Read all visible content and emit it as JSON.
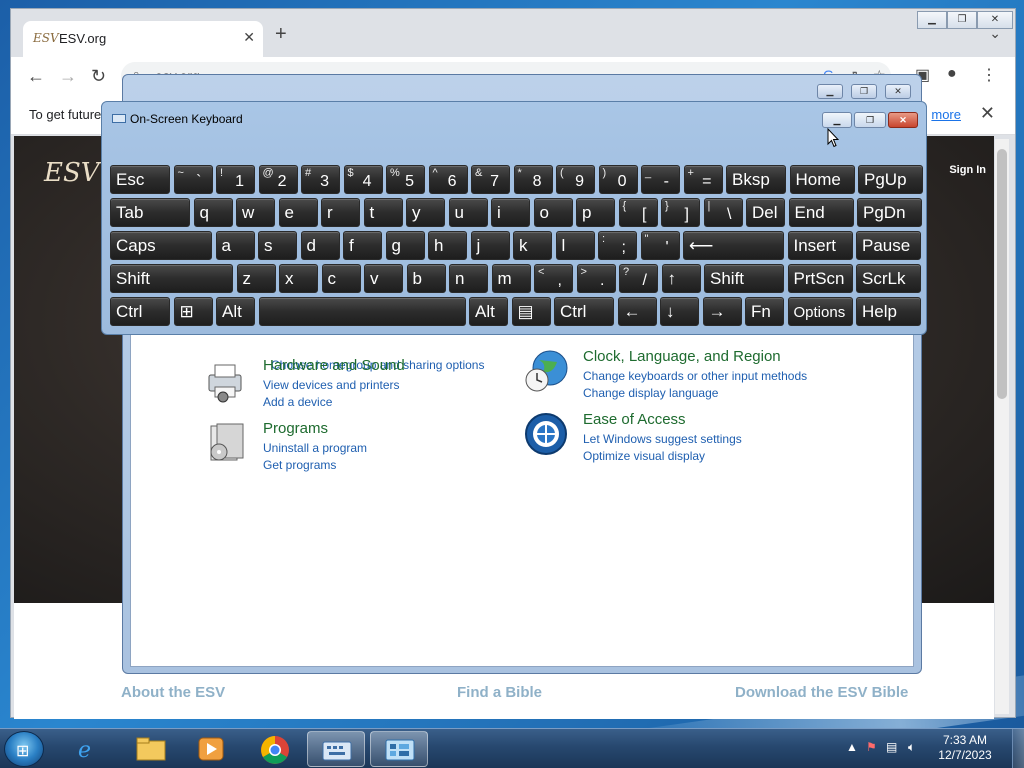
{
  "browser": {
    "tab_title": "ESV.org",
    "tab_favicon": "ESV",
    "url": "esv.org",
    "infobar_text": "To get future",
    "infobar_link": "more"
  },
  "esv_page": {
    "logo": "ESV",
    "sign_in": "Sign In",
    "footer_links": [
      "About the ESV",
      "Find a Bible",
      "Download the ESV Bible"
    ]
  },
  "control_panel": {
    "partial_link": "Choose homegroup and sharing options",
    "items": [
      {
        "title": "Hardware and Sound",
        "links": [
          "View devices and printers",
          "Add a device"
        ],
        "icon": "printer-icon"
      },
      {
        "title": "Programs",
        "links": [
          "Uninstall a program",
          "Get programs"
        ],
        "icon": "programs-icon"
      },
      {
        "title": "Clock, Language, and Region",
        "links": [
          "Change keyboards or other input methods",
          "Change display language"
        ],
        "icon": "globe-clock-icon"
      },
      {
        "title": "Ease of Access",
        "links": [
          "Let Windows suggest settings",
          "Optimize visual display"
        ],
        "icon": "ease-of-access-icon"
      }
    ]
  },
  "osk": {
    "title": "On-Screen Keyboard",
    "rows": [
      [
        [
          "Esc",
          ""
        ],
        [
          "~",
          "`"
        ],
        [
          "!",
          "1"
        ],
        [
          "@",
          "2"
        ],
        [
          "#",
          "3"
        ],
        [
          "$",
          "4"
        ],
        [
          "%",
          "5"
        ],
        [
          "^",
          "6"
        ],
        [
          "&",
          "7"
        ],
        [
          "*",
          "8"
        ],
        [
          "(",
          "9"
        ],
        [
          ")",
          "0"
        ],
        [
          "_",
          "-"
        ],
        [
          "+",
          "="
        ],
        [
          "Bksp",
          ""
        ],
        [
          "Home",
          ""
        ],
        [
          "PgUp",
          ""
        ]
      ],
      [
        [
          "Tab",
          ""
        ],
        [
          "q",
          ""
        ],
        [
          "w",
          ""
        ],
        [
          "e",
          ""
        ],
        [
          "r",
          ""
        ],
        [
          "t",
          ""
        ],
        [
          "y",
          ""
        ],
        [
          "u",
          ""
        ],
        [
          "i",
          ""
        ],
        [
          "o",
          ""
        ],
        [
          "p",
          ""
        ],
        [
          "{",
          "["
        ],
        [
          "}",
          "]"
        ],
        [
          "|",
          "\\"
        ],
        [
          "Del",
          ""
        ],
        [
          "End",
          ""
        ],
        [
          "PgDn",
          ""
        ]
      ],
      [
        [
          "Caps",
          ""
        ],
        [
          "a",
          ""
        ],
        [
          "s",
          ""
        ],
        [
          "d",
          ""
        ],
        [
          "f",
          ""
        ],
        [
          "g",
          ""
        ],
        [
          "h",
          ""
        ],
        [
          "j",
          ""
        ],
        [
          "k",
          ""
        ],
        [
          "l",
          ""
        ],
        [
          ":",
          ";"
        ],
        [
          "\"",
          "'"
        ],
        [
          "⟵",
          ""
        ],
        [
          "Insert",
          ""
        ],
        [
          "Pause",
          ""
        ]
      ],
      [
        [
          "Shift",
          ""
        ],
        [
          "z",
          ""
        ],
        [
          "x",
          ""
        ],
        [
          "c",
          ""
        ],
        [
          "v",
          ""
        ],
        [
          "b",
          ""
        ],
        [
          "n",
          ""
        ],
        [
          "m",
          ""
        ],
        [
          "<",
          ","
        ],
        [
          ">",
          "."
        ],
        [
          "?",
          "/"
        ],
        [
          "↑",
          ""
        ],
        [
          "Shift",
          ""
        ],
        [
          "PrtScn",
          ""
        ],
        [
          "ScrLk",
          ""
        ]
      ],
      [
        [
          "Ctrl",
          ""
        ],
        [
          "⊞",
          ""
        ],
        [
          "Alt",
          ""
        ],
        [
          "",
          ""
        ],
        [
          "Alt",
          ""
        ],
        [
          "▤",
          ""
        ],
        [
          "Ctrl",
          ""
        ],
        [
          "←",
          ""
        ],
        [
          "↓",
          ""
        ],
        [
          "→",
          ""
        ],
        [
          "Fn",
          ""
        ],
        [
          "Options",
          ""
        ],
        [
          "Help",
          ""
        ]
      ]
    ]
  },
  "taskbar": {
    "time": "7:33 AM",
    "date": "12/7/2023",
    "apps": [
      "internet-explorer-icon",
      "file-explorer-icon",
      "media-player-icon",
      "chrome-icon",
      "on-screen-keyboard-icon",
      "control-panel-icon"
    ],
    "tray_icons": [
      "show-hidden-icons-arrow",
      "action-center-flag-icon",
      "network-icon",
      "volume-muted-icon"
    ]
  }
}
